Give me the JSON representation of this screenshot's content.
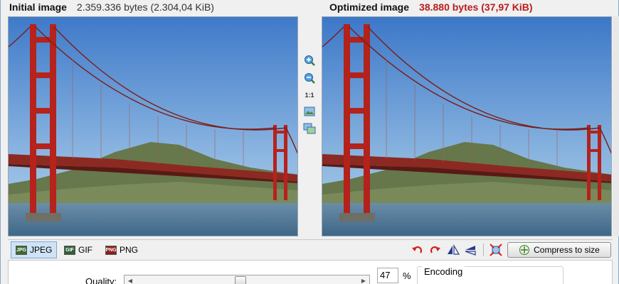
{
  "initial": {
    "label": "Initial image",
    "size": "2.359.336 bytes (2.304,04 KiB)"
  },
  "optimized": {
    "label": "Optimized image",
    "size": "38.880 bytes (37,97 KiB)"
  },
  "middle_tools": {
    "zoom_in": "zoom-in-icon",
    "zoom_out": "zoom-out-icon",
    "actual_size": "1:1",
    "fit": "fit-window-icon",
    "compare": "compare-view-icon"
  },
  "formats": [
    {
      "name": "JPEG",
      "icon_text": "JPG",
      "selected": true
    },
    {
      "name": "GIF",
      "icon_text": "GIF",
      "selected": false
    },
    {
      "name": "PNG",
      "icon_text": "PNG",
      "selected": false
    }
  ],
  "toolbar": {
    "rotate_left": "rotate-left-icon",
    "rotate_right": "rotate-right-icon",
    "flip_horizontal": "flip-horizontal-icon",
    "flip_vertical": "flip-vertical-icon",
    "crop": "crop-icon",
    "compress_label": "Compress to size"
  },
  "quality": {
    "label": "Quality:",
    "value": "47",
    "unit": "%",
    "fraction": 0.47
  },
  "encoding": {
    "title": "Encoding"
  },
  "colors": {
    "optimized_size": "#b81d1d",
    "tower": "#b5231c",
    "sky_top": "#3f7ac9",
    "sky_bottom": "#b3d1ea",
    "water": "#4f7696",
    "hills": "#5e7046"
  }
}
